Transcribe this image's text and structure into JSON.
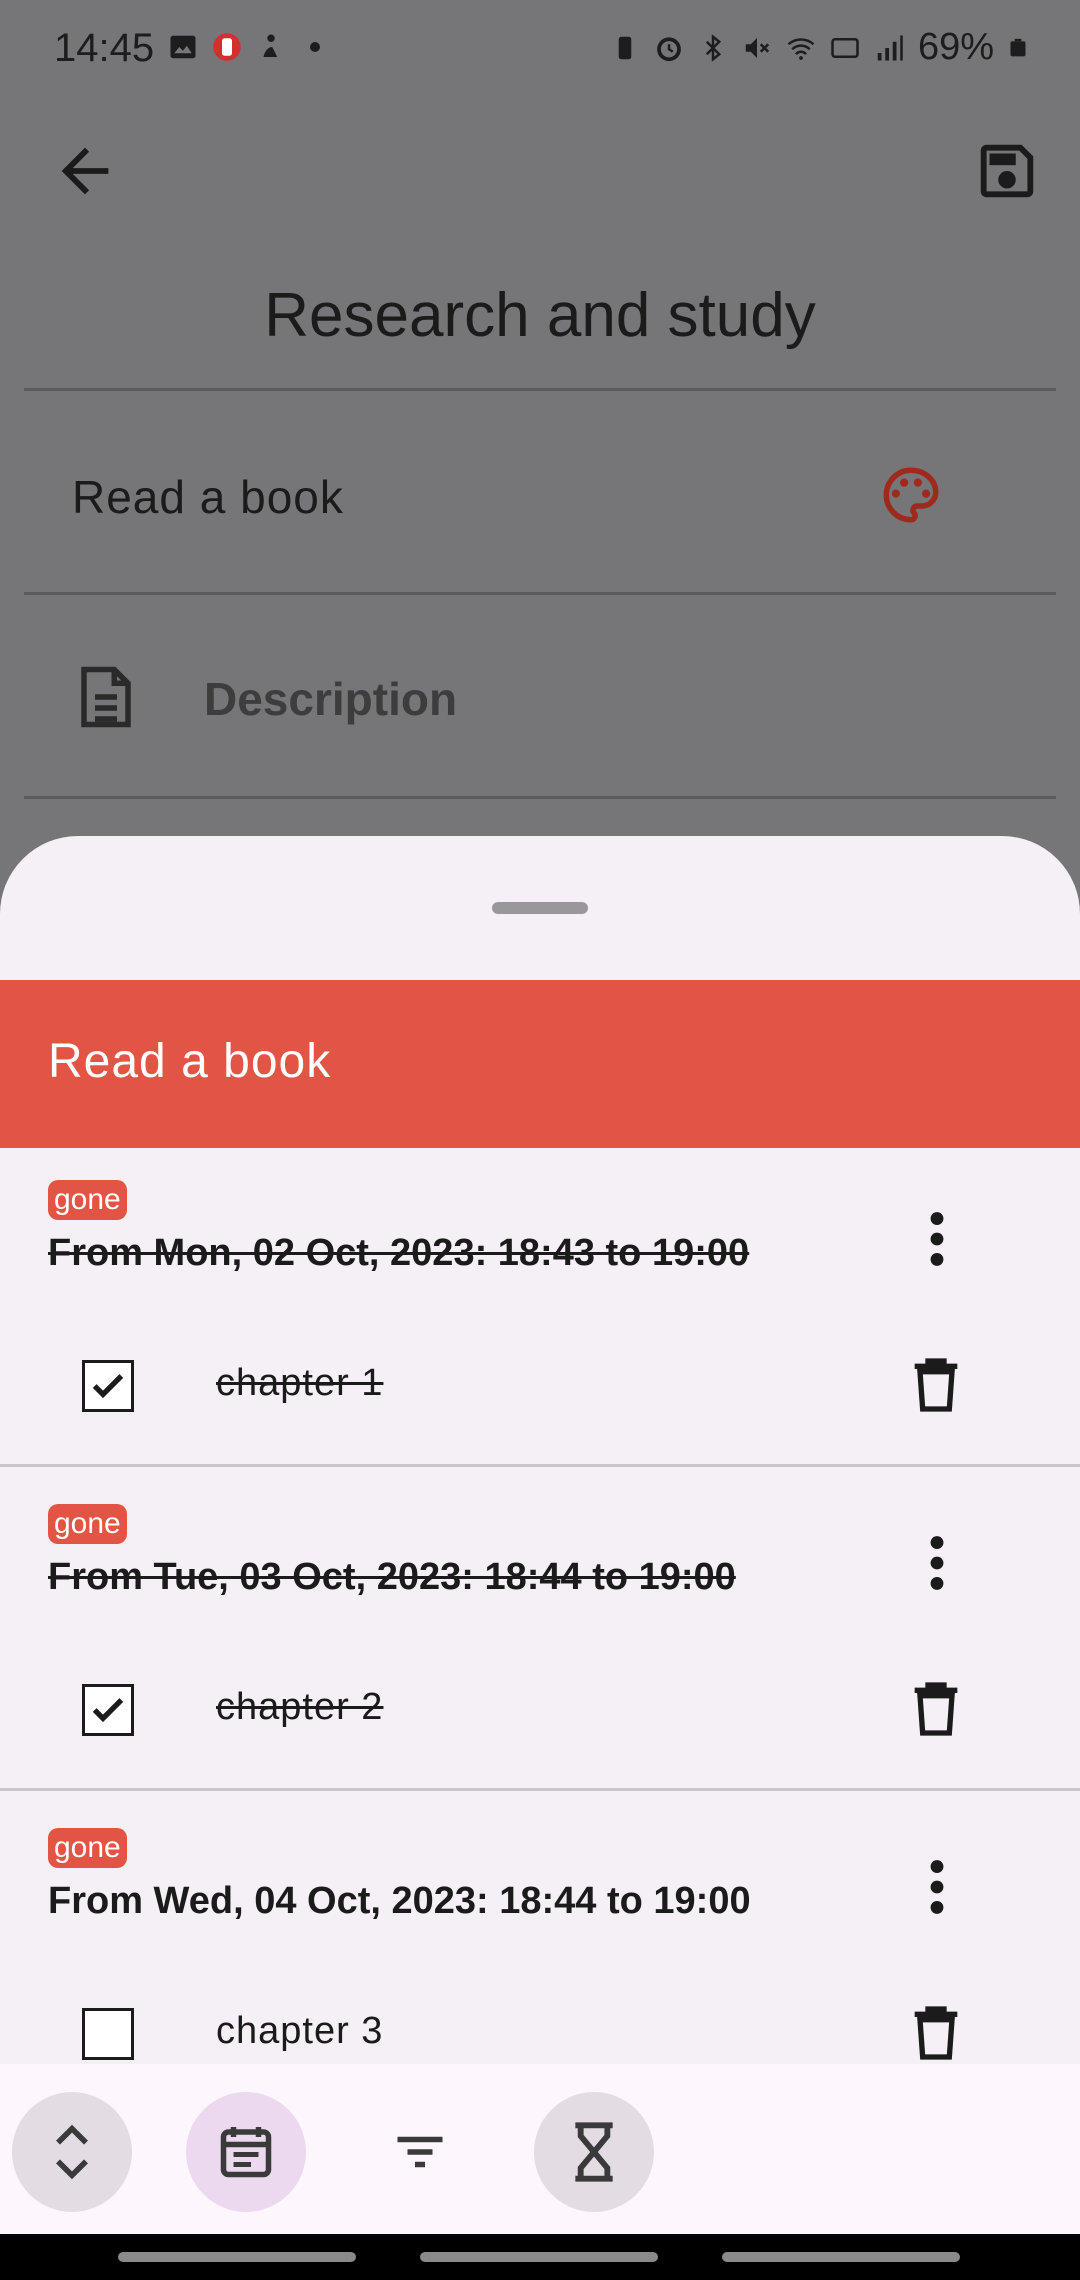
{
  "status_bar": {
    "time": "14:45",
    "battery": "69%"
  },
  "header": {
    "title": "Research and study"
  },
  "form": {
    "name_value": "Read a book",
    "description_placeholder": "Description"
  },
  "sheet": {
    "title": "Read a book",
    "accent_color": "#e25443",
    "slots": [
      {
        "badge": "gone",
        "time": "From Mon, 02 Oct, 2023: 18:43 to 19:00",
        "done": true,
        "task": "chapter 1",
        "checked": true
      },
      {
        "badge": "gone",
        "time": "From Tue, 03 Oct, 2023: 18:44 to 19:00",
        "done": true,
        "task": "chapter 2",
        "checked": true
      },
      {
        "badge": "gone",
        "time": "From Wed, 04 Oct, 2023: 18:44 to 19:00",
        "done": false,
        "task": "chapter 3",
        "checked": false
      }
    ]
  },
  "bottom_bar": {
    "buttons": [
      "expand-collapse-icon",
      "calendar-icon",
      "filter-icon",
      "hourglass-icon"
    ],
    "selected": "calendar-icon"
  }
}
